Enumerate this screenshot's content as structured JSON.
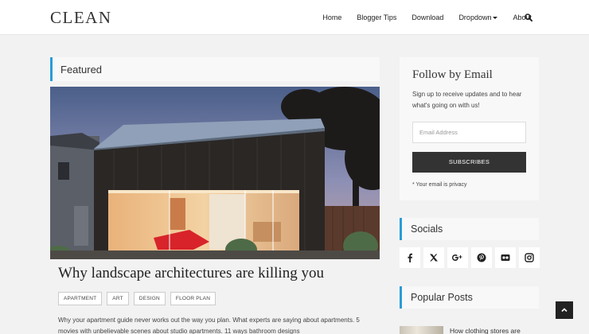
{
  "header": {
    "logo": "CLEAN",
    "nav": [
      "Home",
      "Blogger Tips",
      "Download",
      "Dropdown",
      "About"
    ],
    "search_icon": "search-icon"
  },
  "main": {
    "section_title": "Featured",
    "post_title": "Why landscape architectures are killing you",
    "tags": [
      "APARTMENT",
      "ART",
      "DESIGN",
      "FLOOR PLAN"
    ],
    "excerpt": "Why your apartment guide never works out the way you plan. What experts are saying about apartments. 5 movies with unbelievable scenes about studio apartments. 11 ways bathroom designs"
  },
  "sidebar": {
    "follow": {
      "title": "Follow by Email",
      "description": "Sign up to receive updates and to hear what's going on with us!",
      "email_placeholder": "Email Address",
      "button": "SUBSCRIBES",
      "privacy": "* Your email is privacy"
    },
    "socials": {
      "title": "Socials",
      "icons": [
        "facebook-icon",
        "twitter-icon",
        "google-plus-icon",
        "pinterest-icon",
        "flickr-icon",
        "instagram-icon"
      ]
    },
    "popular": {
      "title": "Popular Posts",
      "first_post": "How clothing stores are"
    }
  },
  "colors": {
    "accent": "#2b9bd8",
    "background": "#f2f2f2",
    "button": "#333333"
  }
}
